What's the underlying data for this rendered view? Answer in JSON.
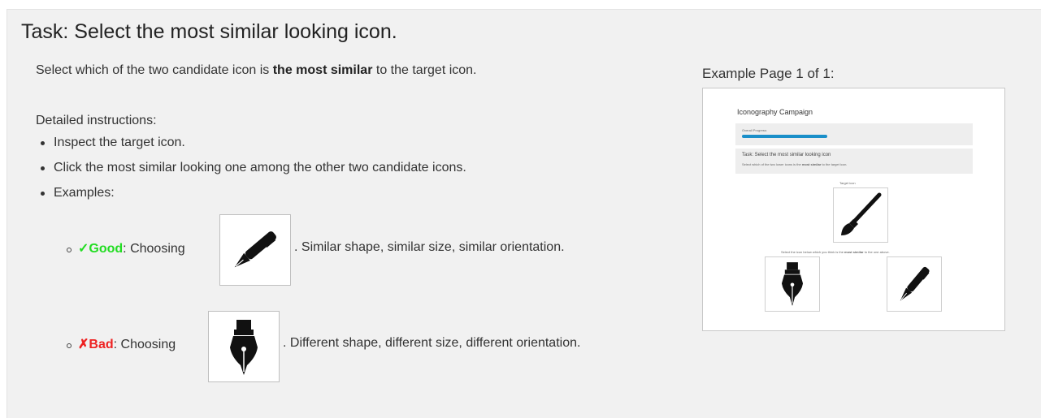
{
  "task": {
    "title": "Task: Select the most similar looking icon.",
    "intro_pre": "Select which of the two candidate icon is ",
    "intro_bold": "the most similar",
    "intro_post": " to the target icon.",
    "detail_heading": "Detailed instructions:",
    "steps": [
      "Inspect the target icon.",
      "Click the most similar looking one among the other two candidate icons.",
      "Examples:"
    ],
    "good": {
      "mark": "✓Good",
      "choosing": ": Choosing",
      "description": ". Similar shape, similar size, similar orientation.",
      "icon": "pen-icon",
      "color": "#22dd22"
    },
    "bad": {
      "mark": "✗Bad",
      "choosing": ": Choosing",
      "description": ". Different shape, different size, different orientation.",
      "icon": "fountain-pen-nib-icon",
      "color": "#ee2222"
    }
  },
  "example": {
    "label": "Example Page 1 of 1:",
    "preview": {
      "app_title": "Iconography Campaign",
      "progress_label": "Overall Progress:",
      "progress_fraction": 0.38,
      "progress_color": "#1a8fc9",
      "task_title": "Task: Select the most similar looking icon",
      "task_desc_pre": "Select which of the two lower icons is the ",
      "task_desc_bold": "most similar",
      "task_desc_post": " to the target icon.",
      "target_label": "Target icon",
      "target_icon": "paintbrush-icon",
      "select_pre": "Select the icon below which you think is the ",
      "select_bold": "most similar",
      "select_post": " to the one above.",
      "candidates": [
        "fountain-pen-nib-icon",
        "pen-icon"
      ]
    }
  }
}
